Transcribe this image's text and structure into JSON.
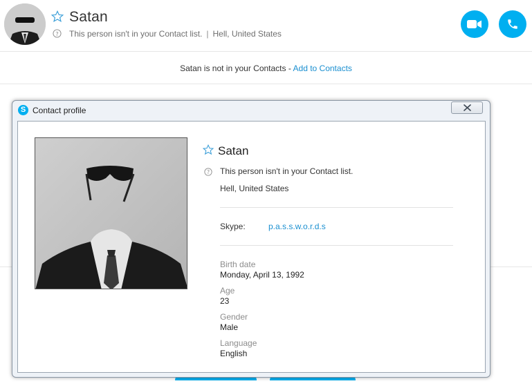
{
  "header": {
    "name": "Satan",
    "status": "This person isn't in your Contact list.",
    "separator": "|",
    "location": "Hell, United States"
  },
  "notice": {
    "text": "Satan is not in your Contacts -",
    "link": "Add to Contacts"
  },
  "dialog": {
    "title": "Contact profile",
    "name": "Satan",
    "status": "This person isn't in your Contact list.",
    "location": "Hell, United States",
    "skype_label": "Skype:",
    "skype_id": "p.a.s.s.w.o.r.d.s",
    "fields": [
      {
        "label": "Birth date",
        "value": "Monday, April 13, 1992"
      },
      {
        "label": "Age",
        "value": "23"
      },
      {
        "label": "Gender",
        "value": "Male"
      },
      {
        "label": "Language",
        "value": "English"
      }
    ]
  },
  "icons": {
    "video": "video-camera-icon",
    "call": "phone-icon",
    "favorite": "star-outline-icon",
    "help": "question-circle-icon",
    "close": "close-x-icon",
    "app": "skype-logo-icon"
  },
  "colors": {
    "accent": "#00aff0",
    "link": "#1a8fd0",
    "dialog_frame": "#eef2f7"
  }
}
